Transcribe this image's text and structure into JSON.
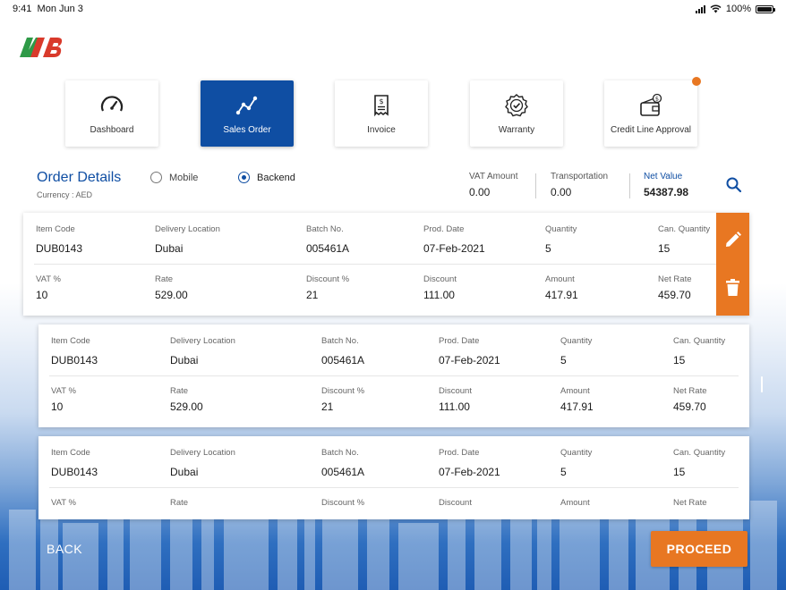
{
  "status_bar": {
    "time": "9:41",
    "date": "Mon Jun 3",
    "battery": "100%"
  },
  "nav": [
    {
      "label": "Dashboard",
      "icon": "gauge-icon"
    },
    {
      "label": "Sales Order",
      "icon": "line-chart-icon",
      "active": true
    },
    {
      "label": "Invoice",
      "icon": "invoice-icon"
    },
    {
      "label": "Warranty",
      "icon": "warranty-badge-icon"
    },
    {
      "label": "Credit Line Approval",
      "icon": "credit-wallet-icon",
      "notification": true
    }
  ],
  "order": {
    "title": "Order Details",
    "currency": "Currency : AED",
    "radio_mobile": "Mobile",
    "radio_backend": "Backend",
    "selected": "Backend"
  },
  "summary": {
    "vat_label": "VAT Amount",
    "vat_value": "0.00",
    "transport_label": "Transportation",
    "transport_value": "0.00",
    "net_label": "Net Value",
    "net_value": "54387.98"
  },
  "columns_top": [
    "Item Code",
    "Delivery Location",
    "Batch No.",
    "Prod. Date",
    "Quantity",
    "Can. Quantity"
  ],
  "columns_bottom": [
    "VAT %",
    "Rate",
    "Discount %",
    "Discount",
    "Amount",
    "Net Rate"
  ],
  "items": [
    {
      "top": [
        "DUB0143",
        "Dubai",
        "005461A",
        "07-Feb-2021",
        "5",
        "15"
      ],
      "bottom": [
        "10",
        "529.00",
        "21",
        "111.00",
        "417.91",
        "459.70"
      ]
    },
    {
      "top": [
        "DUB0143",
        "Dubai",
        "005461A",
        "07-Feb-2021",
        "5",
        "15"
      ],
      "bottom": [
        "10",
        "529.00",
        "21",
        "111.00",
        "417.91",
        "459.70"
      ]
    },
    {
      "top": [
        "DUB0143",
        "Dubai",
        "005461A",
        "07-Feb-2021",
        "5",
        "15"
      ],
      "bottom": [
        "",
        "",
        "",
        "",
        "",
        ""
      ]
    }
  ],
  "footer": {
    "back": "BACK",
    "proceed": "PROCEED"
  },
  "colors": {
    "brand_blue": "#0f4ea3",
    "accent_orange": "#e87722"
  }
}
